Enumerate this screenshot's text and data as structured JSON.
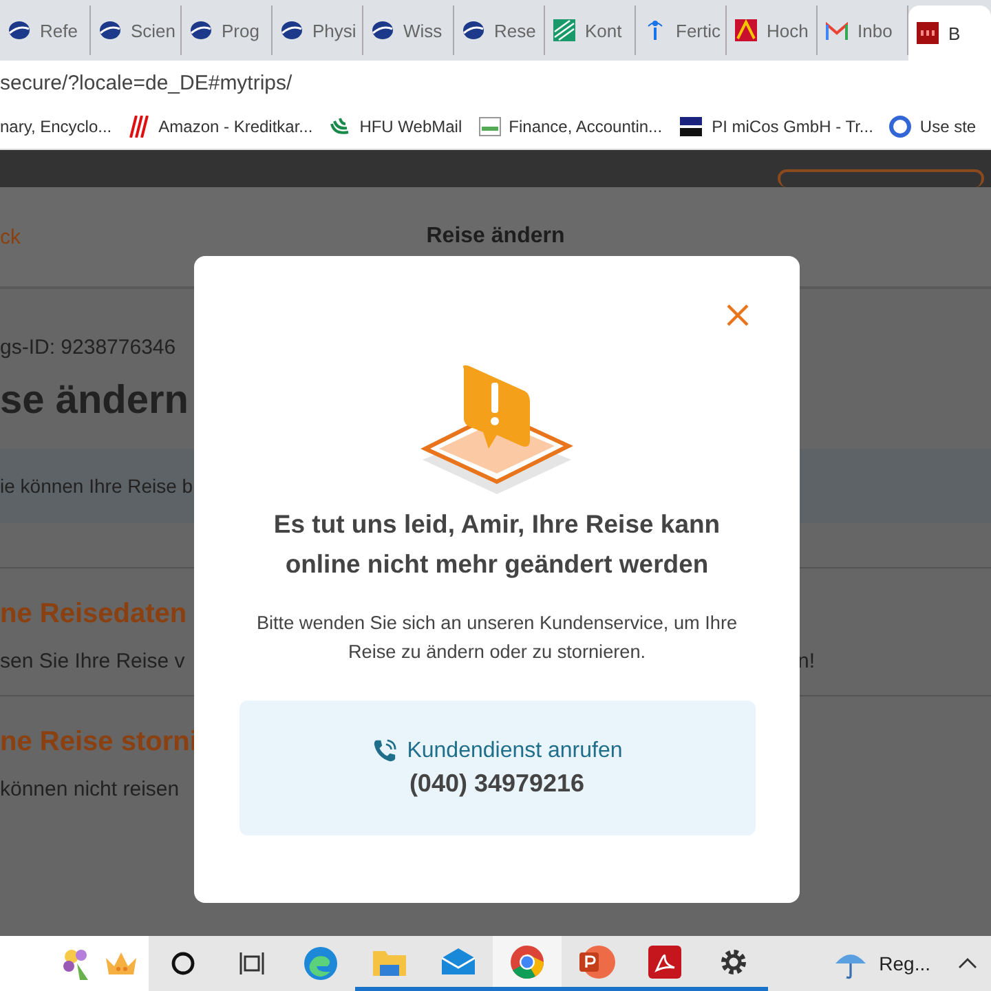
{
  "browser": {
    "tabs": [
      {
        "label": "Refe",
        "selected": false
      },
      {
        "label": "Scien",
        "selected": false
      },
      {
        "label": "Prog",
        "selected": false
      },
      {
        "label": "Physi",
        "selected": false
      },
      {
        "label": "Wiss",
        "selected": false
      },
      {
        "label": "Rese",
        "selected": false
      },
      {
        "label": "Kont",
        "selected": false
      },
      {
        "label": "Fertic",
        "selected": false
      },
      {
        "label": "Hoch",
        "selected": false
      },
      {
        "label": "Inbo",
        "selected": false
      },
      {
        "label": "B",
        "selected": true
      }
    ],
    "address": "secure/?locale=de_DE#mytrips/",
    "bookmarks": [
      "nary, Encyclo...",
      "Amazon - Kreditkar...",
      "HFU WebMail",
      "Finance, Accountin...",
      "PI miCos GmbH - Tr...",
      "Use ste"
    ]
  },
  "page": {
    "back_link": "ck",
    "header_title": "Reise ändern",
    "booking_id": "gs-ID: 9238776346",
    "heading": "se ändern",
    "info": "ie können Ihre Reise b",
    "sections": [
      {
        "title": "ne Reisedaten",
        "text": "sen Sie Ihre Reise v",
        "text_end": "n!"
      },
      {
        "title": "ne Reise storni",
        "text": "können nicht reisen"
      }
    ]
  },
  "dialog": {
    "title": "Es tut uns leid, Amir, Ihre Reise kann online nicht mehr geändert werden",
    "message": "Bitte wenden Sie sich an unseren Kundenservice, um Ihre Reise zu ändern oder zu stornieren.",
    "call_label": "Kundendienst anrufen",
    "phone": "(040) 34979216"
  },
  "taskbar": {
    "weather": "Reg..."
  }
}
